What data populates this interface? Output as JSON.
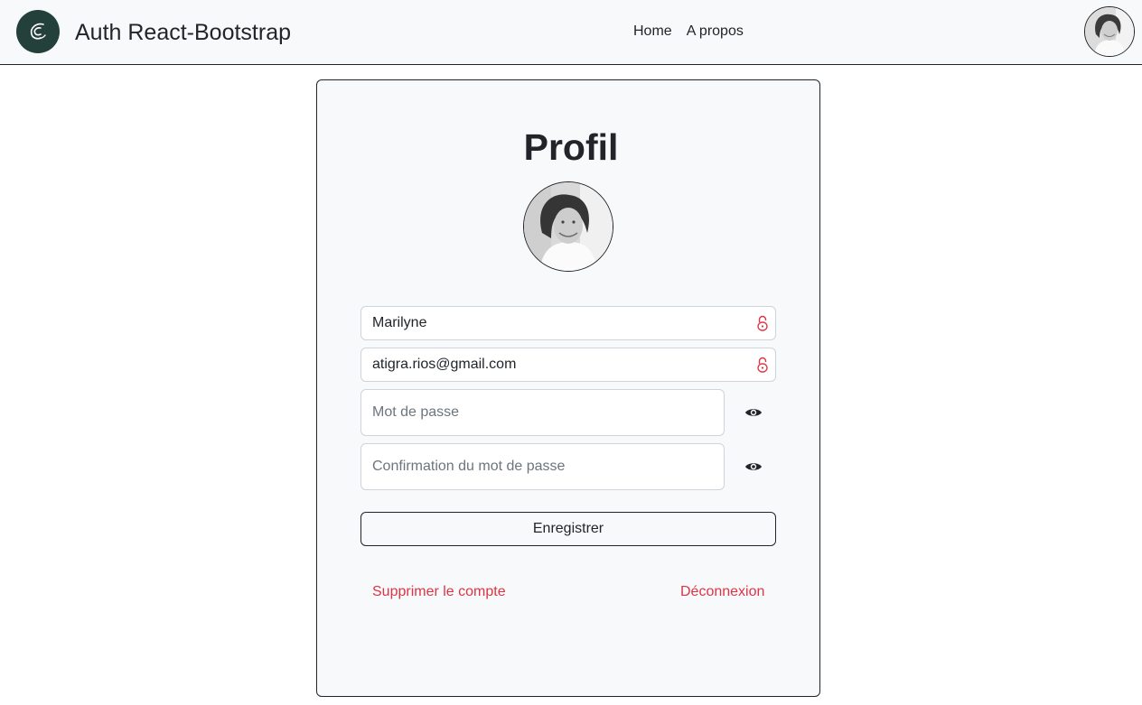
{
  "navbar": {
    "brand_title": "Auth React-Bootstrap",
    "links": [
      "Home",
      "A propos"
    ],
    "logo_icon": "wave-logo-icon",
    "avatar_icon": "user-avatar"
  },
  "profile": {
    "title": "Profil",
    "avatar_icon": "profile-photo",
    "name_value": "Marilyne",
    "email_value": "atigra.rios@gmail.com",
    "password_placeholder": "Mot de passe",
    "password_confirm_placeholder": "Confirmation du mot de passe",
    "lock_icon": "unlock-icon",
    "eye_icon": "eye-icon",
    "save_label": "Enregistrer",
    "delete_label": "Supprimer le compte",
    "logout_label": "Déconnexion"
  },
  "colors": {
    "navbar_bg": "#f8f9fa",
    "logo_bg": "#24403b",
    "danger": "#dc3545",
    "text": "#212529"
  }
}
